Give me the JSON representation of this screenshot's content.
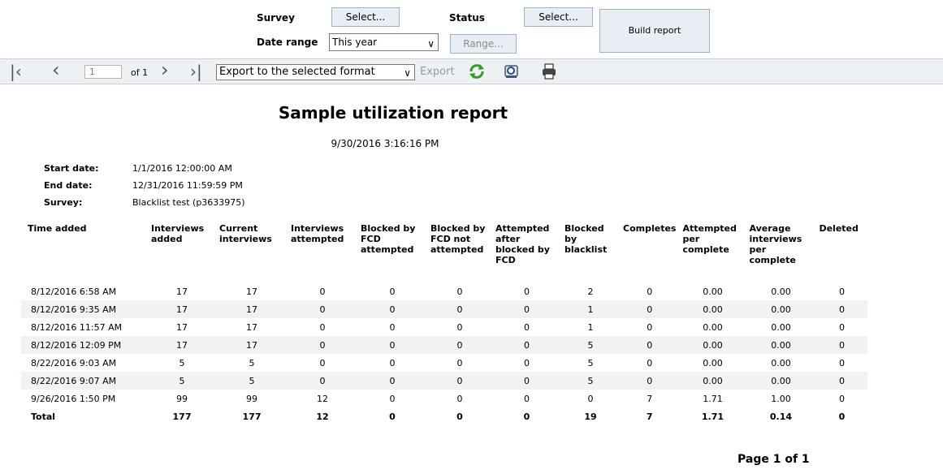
{
  "filters": {
    "survey_label": "Survey",
    "survey_button": "Select...",
    "status_label": "Status",
    "status_button": "Select...",
    "date_range_label": "Date range",
    "date_range_value": "This year",
    "range_button": "Range...",
    "build_report_button": "Build report"
  },
  "toolbar": {
    "page_input": "1",
    "of_pages": "of 1",
    "export_format": "Export to the selected format",
    "export_label": "Export"
  },
  "report": {
    "title": "Sample utilization report",
    "timestamp": "9/30/2016 3:16:16 PM",
    "meta": [
      {
        "label": "Start date:",
        "value": "1/1/2016 12:00:00 AM"
      },
      {
        "label": "End date:",
        "value": "12/31/2016 11:59:59 PM"
      },
      {
        "label": "Survey:",
        "value": "Blacklist test (p3633975)"
      }
    ],
    "columns": [
      "Time added",
      "Interviews added",
      "Current interviews",
      "Interviews attempted",
      "Blocked by FCD attempted",
      "Blocked by FCD not attempted",
      "Attempted after blocked by FCD",
      "Blocked by blacklist",
      "Completes",
      "Attempted per complete",
      "Average interviews per complete",
      "Deleted"
    ],
    "rows": [
      [
        "8/12/2016 6:58 AM",
        "17",
        "17",
        "0",
        "0",
        "0",
        "0",
        "2",
        "0",
        "0.00",
        "0.00",
        "0"
      ],
      [
        "8/12/2016 9:35 AM",
        "17",
        "17",
        "0",
        "0",
        "0",
        "0",
        "1",
        "0",
        "0.00",
        "0.00",
        "0"
      ],
      [
        "8/12/2016 11:57 AM",
        "17",
        "17",
        "0",
        "0",
        "0",
        "0",
        "1",
        "0",
        "0.00",
        "0.00",
        "0"
      ],
      [
        "8/12/2016 12:09 PM",
        "17",
        "17",
        "0",
        "0",
        "0",
        "0",
        "5",
        "0",
        "0.00",
        "0.00",
        "0"
      ],
      [
        "8/22/2016 9:03 AM",
        "5",
        "5",
        "0",
        "0",
        "0",
        "0",
        "5",
        "0",
        "0.00",
        "0.00",
        "0"
      ],
      [
        "8/22/2016 9:07 AM",
        "5",
        "5",
        "0",
        "0",
        "0",
        "0",
        "5",
        "0",
        "0.00",
        "0.00",
        "0"
      ],
      [
        "9/26/2016 1:50 PM",
        "99",
        "99",
        "12",
        "0",
        "0",
        "0",
        "0",
        "7",
        "1.71",
        "1.00",
        "0"
      ]
    ],
    "total": [
      "Total",
      "177",
      "177",
      "12",
      "0",
      "0",
      "0",
      "19",
      "7",
      "1.71",
      "0.14",
      "0"
    ],
    "page_footer": "Page 1 of 1"
  }
}
